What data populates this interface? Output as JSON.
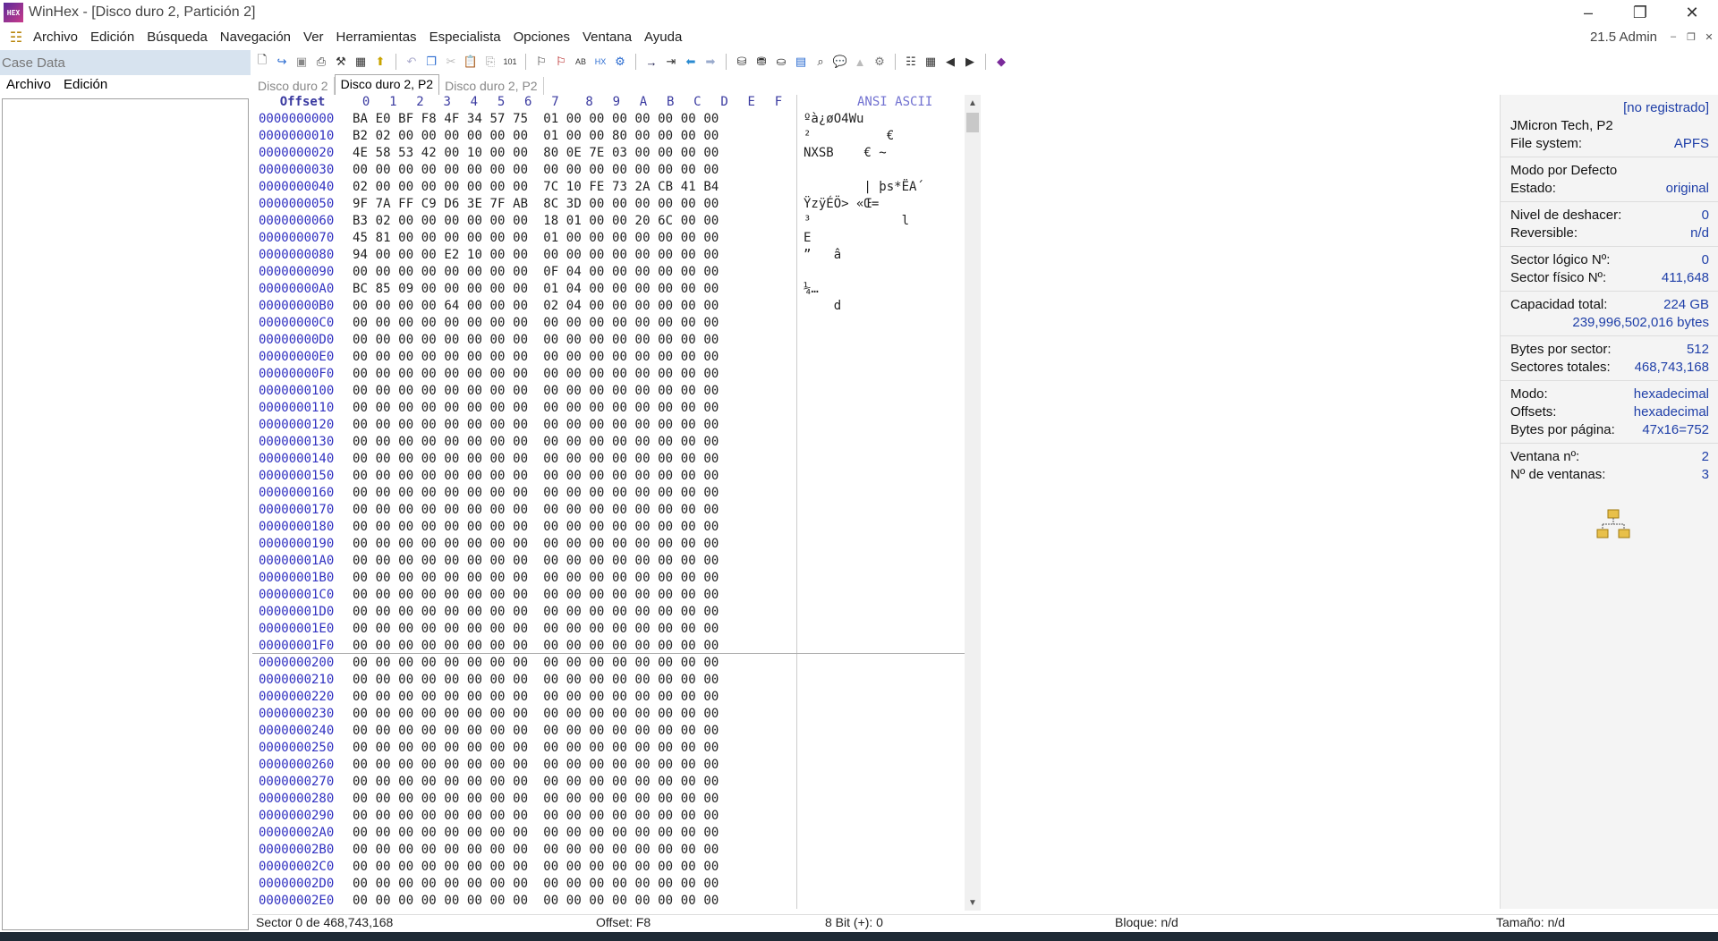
{
  "window": {
    "title": "WinHex - [Disco duro 2, Partición 2]",
    "logo_text": "HEX"
  },
  "menu": {
    "items": [
      "Archivo",
      "Edición",
      "Búsqueda",
      "Navegación",
      "Ver",
      "Herramientas",
      "Especialista",
      "Opciones",
      "Ventana",
      "Ayuda"
    ],
    "right_label": "21.5 Admin"
  },
  "case_panel": {
    "header": "Case Data",
    "menu": [
      "Archivo",
      "Edición"
    ]
  },
  "tabs": [
    {
      "label": "Disco duro 2",
      "active": false
    },
    {
      "label": "Disco duro 2, P2",
      "active": true
    },
    {
      "label": "Disco duro 2, P2",
      "active": false
    }
  ],
  "hex": {
    "header": {
      "offset": "Offset",
      "columns": [
        "0",
        "1",
        "2",
        "3",
        "4",
        "5",
        "6",
        "7",
        "8",
        "9",
        "A",
        "B",
        "C",
        "D",
        "E",
        "F"
      ],
      "ansi": "ANSI ASCII"
    },
    "rows": [
      {
        "offset": "0000000000",
        "bytes": "BA E0 BF F8 4F 34 57 75  01 00 00 00 00 00 00 00",
        "ansi": "ºà¿øO4Wu"
      },
      {
        "offset": "0000000010",
        "bytes": "B2 02 00 00 00 00 00 00  01 00 00 80 00 00 00 00",
        "ansi": "²          €"
      },
      {
        "offset": "0000000020",
        "bytes": "4E 58 53 42 00 10 00 00  80 0E 7E 03 00 00 00 00",
        "ansi": "NXSB    € ~"
      },
      {
        "offset": "0000000030",
        "bytes": "00 00 00 00 00 00 00 00  00 00 00 00 00 00 00 00",
        "ansi": ""
      },
      {
        "offset": "0000000040",
        "bytes": "02 00 00 00 00 00 00 00  7C 10 FE 73 2A CB 41 B4",
        "ansi": "        | þs*ËA´"
      },
      {
        "offset": "0000000050",
        "bytes": "9F 7A FF C9 D6 3E 7F AB  8C 3D 00 00 00 00 00 00",
        "ansi": "ŸzÿÉÖ> «Œ="
      },
      {
        "offset": "0000000060",
        "bytes": "B3 02 00 00 00 00 00 00  18 01 00 00 20 6C 00 00",
        "ansi": "³            l"
      },
      {
        "offset": "0000000070",
        "bytes": "45 81 00 00 00 00 00 00  01 00 00 00 00 00 00 00",
        "ansi": "E"
      },
      {
        "offset": "0000000080",
        "bytes": "94 00 00 00 E2 10 00 00  00 00 00 00 00 00 00 00",
        "ansi": "”   â"
      },
      {
        "offset": "0000000090",
        "bytes": "00 00 00 00 00 00 00 00  0F 04 00 00 00 00 00 00",
        "ansi": ""
      },
      {
        "offset": "00000000A0",
        "bytes": "BC 85 09 00 00 00 00 00  01 04 00 00 00 00 00 00",
        "ansi": "¼…"
      },
      {
        "offset": "00000000B0",
        "bytes": "00 00 00 00 64 00 00 00  02 04 00 00 00 00 00 00",
        "ansi": "    d"
      },
      {
        "offset": "00000000C0",
        "bytes": "00 00 00 00 00 00 00 00  00 00 00 00 00 00 00 00",
        "ansi": ""
      },
      {
        "offset": "00000000D0",
        "bytes": "00 00 00 00 00 00 00 00  00 00 00 00 00 00 00 00",
        "ansi": ""
      },
      {
        "offset": "00000000E0",
        "bytes": "00 00 00 00 00 00 00 00  00 00 00 00 00 00 00 00",
        "ansi": ""
      },
      {
        "offset": "00000000F0",
        "bytes": "00 00 00 00 00 00 00 00  00 00 00 00 00 00 00 00",
        "ansi": ""
      },
      {
        "offset": "0000000100",
        "bytes": "00 00 00 00 00 00 00 00  00 00 00 00 00 00 00 00",
        "ansi": ""
      },
      {
        "offset": "0000000110",
        "bytes": "00 00 00 00 00 00 00 00  00 00 00 00 00 00 00 00",
        "ansi": ""
      },
      {
        "offset": "0000000120",
        "bytes": "00 00 00 00 00 00 00 00  00 00 00 00 00 00 00 00",
        "ansi": ""
      },
      {
        "offset": "0000000130",
        "bytes": "00 00 00 00 00 00 00 00  00 00 00 00 00 00 00 00",
        "ansi": ""
      },
      {
        "offset": "0000000140",
        "bytes": "00 00 00 00 00 00 00 00  00 00 00 00 00 00 00 00",
        "ansi": ""
      },
      {
        "offset": "0000000150",
        "bytes": "00 00 00 00 00 00 00 00  00 00 00 00 00 00 00 00",
        "ansi": ""
      },
      {
        "offset": "0000000160",
        "bytes": "00 00 00 00 00 00 00 00  00 00 00 00 00 00 00 00",
        "ansi": ""
      },
      {
        "offset": "0000000170",
        "bytes": "00 00 00 00 00 00 00 00  00 00 00 00 00 00 00 00",
        "ansi": ""
      },
      {
        "offset": "0000000180",
        "bytes": "00 00 00 00 00 00 00 00  00 00 00 00 00 00 00 00",
        "ansi": ""
      },
      {
        "offset": "0000000190",
        "bytes": "00 00 00 00 00 00 00 00  00 00 00 00 00 00 00 00",
        "ansi": ""
      },
      {
        "offset": "00000001A0",
        "bytes": "00 00 00 00 00 00 00 00  00 00 00 00 00 00 00 00",
        "ansi": ""
      },
      {
        "offset": "00000001B0",
        "bytes": "00 00 00 00 00 00 00 00  00 00 00 00 00 00 00 00",
        "ansi": ""
      },
      {
        "offset": "00000001C0",
        "bytes": "00 00 00 00 00 00 00 00  00 00 00 00 00 00 00 00",
        "ansi": ""
      },
      {
        "offset": "00000001D0",
        "bytes": "00 00 00 00 00 00 00 00  00 00 00 00 00 00 00 00",
        "ansi": ""
      },
      {
        "offset": "00000001E0",
        "bytes": "00 00 00 00 00 00 00 00  00 00 00 00 00 00 00 00",
        "ansi": ""
      },
      {
        "offset": "00000001F0",
        "bytes": "00 00 00 00 00 00 00 00  00 00 00 00 00 00 00 00",
        "ansi": ""
      },
      {
        "offset": "0000000200",
        "bytes": "00 00 00 00 00 00 00 00  00 00 00 00 00 00 00 00",
        "ansi": ""
      },
      {
        "offset": "0000000210",
        "bytes": "00 00 00 00 00 00 00 00  00 00 00 00 00 00 00 00",
        "ansi": ""
      },
      {
        "offset": "0000000220",
        "bytes": "00 00 00 00 00 00 00 00  00 00 00 00 00 00 00 00",
        "ansi": ""
      },
      {
        "offset": "0000000230",
        "bytes": "00 00 00 00 00 00 00 00  00 00 00 00 00 00 00 00",
        "ansi": ""
      },
      {
        "offset": "0000000240",
        "bytes": "00 00 00 00 00 00 00 00  00 00 00 00 00 00 00 00",
        "ansi": ""
      },
      {
        "offset": "0000000250",
        "bytes": "00 00 00 00 00 00 00 00  00 00 00 00 00 00 00 00",
        "ansi": ""
      },
      {
        "offset": "0000000260",
        "bytes": "00 00 00 00 00 00 00 00  00 00 00 00 00 00 00 00",
        "ansi": ""
      },
      {
        "offset": "0000000270",
        "bytes": "00 00 00 00 00 00 00 00  00 00 00 00 00 00 00 00",
        "ansi": ""
      },
      {
        "offset": "0000000280",
        "bytes": "00 00 00 00 00 00 00 00  00 00 00 00 00 00 00 00",
        "ansi": ""
      },
      {
        "offset": "0000000290",
        "bytes": "00 00 00 00 00 00 00 00  00 00 00 00 00 00 00 00",
        "ansi": ""
      },
      {
        "offset": "00000002A0",
        "bytes": "00 00 00 00 00 00 00 00  00 00 00 00 00 00 00 00",
        "ansi": ""
      },
      {
        "offset": "00000002B0",
        "bytes": "00 00 00 00 00 00 00 00  00 00 00 00 00 00 00 00",
        "ansi": ""
      },
      {
        "offset": "00000002C0",
        "bytes": "00 00 00 00 00 00 00 00  00 00 00 00 00 00 00 00",
        "ansi": ""
      },
      {
        "offset": "00000002D0",
        "bytes": "00 00 00 00 00 00 00 00  00 00 00 00 00 00 00 00",
        "ansi": ""
      },
      {
        "offset": "00000002E0",
        "bytes": "00 00 00 00 00 00 00 00  00 00 00 00 00 00 00 00",
        "ansi": ""
      }
    ]
  },
  "info": {
    "registration": "[no registrado]",
    "device": "JMicron Tech, P2",
    "fs_label": "File system:",
    "fs_value": "APFS",
    "mode_default": "Modo por Defecto",
    "estado_label": "Estado:",
    "estado_value": "original",
    "undo_label": "Nivel de deshacer:",
    "undo_value": "0",
    "reversible_label": "Reversible:",
    "reversible_value": "n/d",
    "logical_label": "Sector lógico Nº:",
    "logical_value": "0",
    "physical_label": "Sector físico Nº:",
    "physical_value": "411,648",
    "capacity_label": "Capacidad total:",
    "capacity_value": "224 GB",
    "capacity_bytes": "239,996,502,016 bytes",
    "bps_label": "Bytes por sector:",
    "bps_value": "512",
    "total_sectors_label": "Sectores totales:",
    "total_sectors_value": "468,743,168",
    "modo_label": "Modo:",
    "modo_value": "hexadecimal",
    "offsets_label": "Offsets:",
    "offsets_value": "hexadecimal",
    "bpp_label": "Bytes por página:",
    "bpp_value": "47x16=752",
    "window_no_label": "Ventana nº:",
    "window_no_value": "2",
    "windows_count_label": "Nº de ventanas:",
    "windows_count_value": "3"
  },
  "status": {
    "sector": "Sector 0 de 468,743,168",
    "offset": "Offset: F8",
    "bit": "8 Bit (+): 0",
    "block": "Bloque: n/d",
    "size": "Tamaño: n/d"
  }
}
